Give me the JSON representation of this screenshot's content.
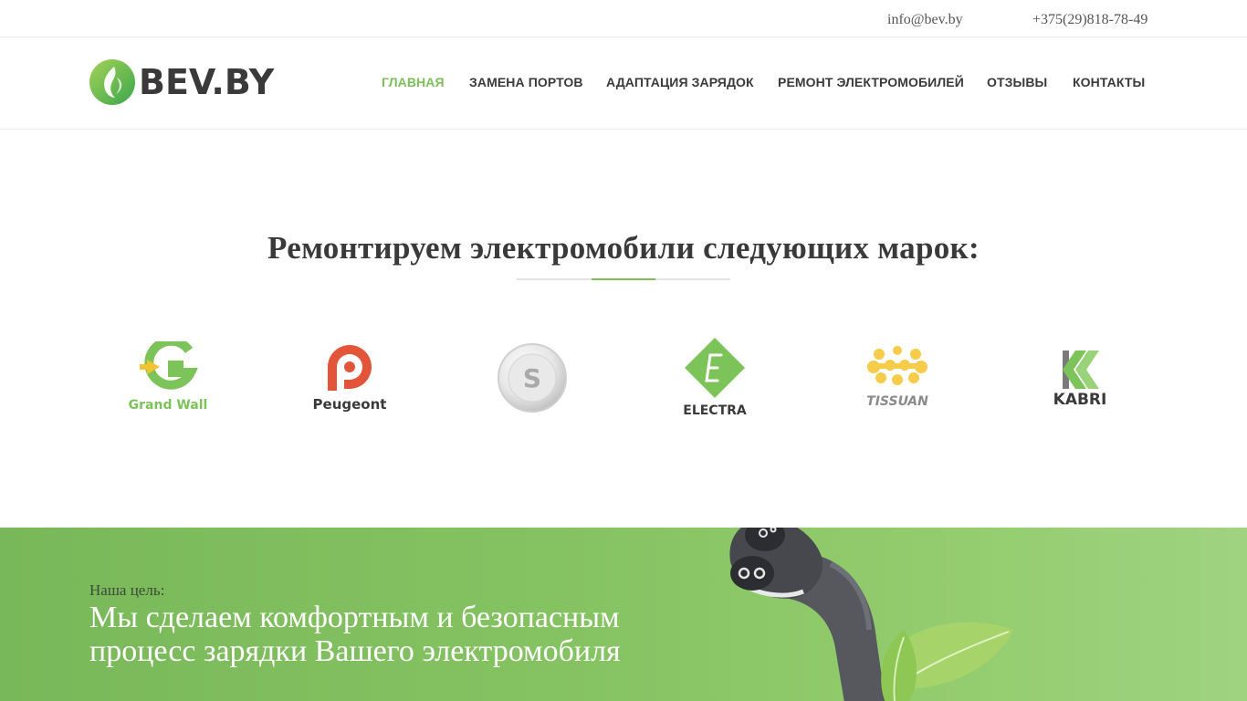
{
  "topbar": {
    "email": "info@bev.by",
    "phone": "+375(29)818-78-49"
  },
  "header": {
    "logo_text": "BEV.BY",
    "logo_icon": "leaf-flame-icon",
    "nav": [
      {
        "label": "ГЛАВНАЯ",
        "active": true
      },
      {
        "label": "ЗАМЕНА ПОРТОВ",
        "active": false
      },
      {
        "label": "АДАПТАЦИЯ ЗАРЯДОК",
        "active": false
      },
      {
        "label": "РЕМОНТ ЭЛЕКТРОМОБИЛЕЙ",
        "active": false
      },
      {
        "label": "ОТЗЫВЫ",
        "active": false
      },
      {
        "label": "КОНТАКТЫ",
        "active": false
      }
    ]
  },
  "brands": {
    "title": "Ремонтируем электромобили следующих марок:",
    "items": [
      {
        "name": "Grand Wall",
        "icon": "grand-wall-logo"
      },
      {
        "name": "Peugeont",
        "icon": "peugeont-logo"
      },
      {
        "name": "",
        "icon": "silver-s-logo"
      },
      {
        "name": "ELECTRA",
        "icon": "electra-logo"
      },
      {
        "name": "TISSUAN",
        "icon": "tissuan-logo"
      },
      {
        "name": "KABRI",
        "icon": "kabri-logo"
      }
    ]
  },
  "banner": {
    "kicker": "Наша цель:",
    "headline": "Мы сделаем комфортным и безопасным процесс зарядки Вашего электромобиля",
    "art_icon": "ev-charging-plug-with-leaves"
  },
  "colors": {
    "accent": "#7cbf5a",
    "text_dark": "#3a3a3a",
    "banner_green": "#85c262",
    "peugeont_red": "#e2553b",
    "tissuan_yellow": "#f6cc4a"
  }
}
